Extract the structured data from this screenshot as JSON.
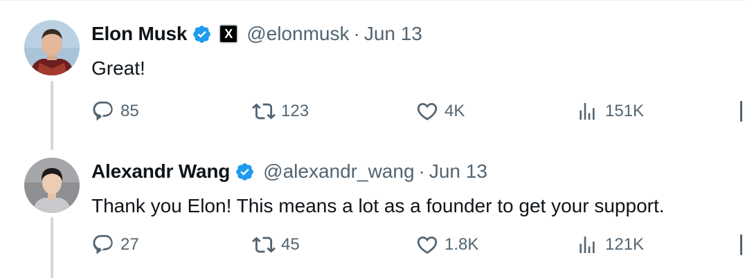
{
  "tweets": [
    {
      "name": "Elon Musk",
      "handle": "@elonmusk",
      "separator": "·",
      "date": "Jun 13",
      "text": "Great!",
      "has_x_badge": true,
      "x_badge_label": "X",
      "stats": {
        "replies": "85",
        "retweets": "123",
        "likes": "4K",
        "views": "151K"
      }
    },
    {
      "name": "Alexandr Wang",
      "handle": "@alexandr_wang",
      "separator": "·",
      "date": "Jun 13",
      "text": "Thank you Elon! This means a lot as a founder to get your support.",
      "has_x_badge": false,
      "stats": {
        "replies": "27",
        "retweets": "45",
        "likes": "1.8K",
        "views": "121K"
      }
    }
  ],
  "colors": {
    "text_primary": "#0f1419",
    "text_secondary": "#536471",
    "verified_blue": "#1d9bf0",
    "thread_line": "#cfd9de"
  },
  "icons": [
    "reply-icon",
    "retweet-icon",
    "like-icon",
    "views-icon",
    "bookmark-icon",
    "verified-badge-icon",
    "x-affiliation-icon"
  ]
}
